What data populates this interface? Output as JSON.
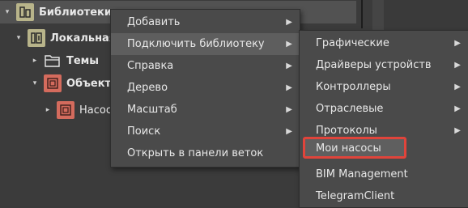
{
  "tree": {
    "rows": [
      {
        "label": "Библиотеки"
      },
      {
        "label": "Локальная"
      },
      {
        "label": "Темы"
      },
      {
        "label": "Объекты"
      },
      {
        "label": "Насосы"
      }
    ]
  },
  "context_menu": {
    "items": [
      {
        "label": "Добавить",
        "arrow": "▶"
      },
      {
        "label": "Подключить библиотеку",
        "arrow": "▶"
      },
      {
        "label": "Справка",
        "arrow": "▶"
      },
      {
        "label": "Дерево",
        "arrow": "▶"
      },
      {
        "label": "Масштаб",
        "arrow": "▶"
      },
      {
        "label": "Поиск",
        "arrow": "▶"
      },
      {
        "label": "Открыть в панели веток"
      }
    ]
  },
  "submenu": {
    "items": [
      {
        "label": "Графические",
        "arrow": "▶"
      },
      {
        "label": "Драйверы устройств",
        "arrow": "▶"
      },
      {
        "label": "Контроллеры",
        "arrow": "▶"
      },
      {
        "label": "Отраслевые",
        "arrow": "▶"
      },
      {
        "label": "Протоколы",
        "arrow": "▶"
      },
      {
        "label": "Мои насосы"
      },
      {
        "label": "BIM Management"
      },
      {
        "label": "TelegramClient"
      }
    ]
  },
  "colors": {
    "highlight_border": "#e0443b",
    "library_icon": "#b8b48a",
    "object_icon": "#d46b5d"
  }
}
